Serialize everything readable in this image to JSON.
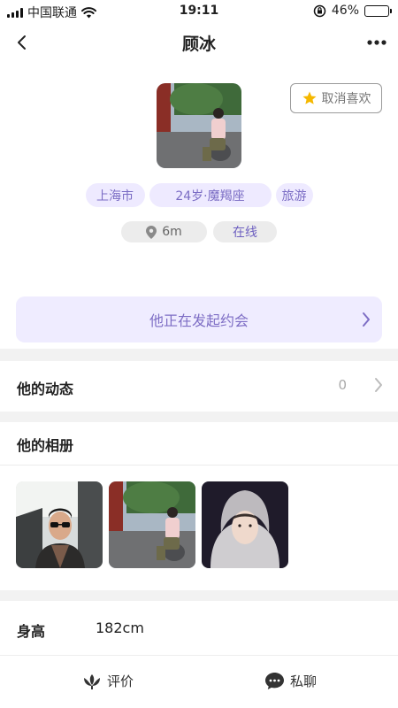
{
  "status_bar": {
    "carrier": "中国联通",
    "time": "19:11",
    "battery": "46%",
    "battery_level": 0.46,
    "icons": [
      "signal-icon",
      "wifi-icon",
      "orientation-lock-icon",
      "battery-icon"
    ]
  },
  "nav": {
    "title": "顾冰",
    "back_icon": "chevron-left-icon",
    "more_icon": "more-dots-icon"
  },
  "profile": {
    "unlike_label": "取消喜欢",
    "tags": [
      "上海市",
      "24岁·魔羯座",
      "旅游"
    ],
    "distance": "6m",
    "status": "在线"
  },
  "date_banner": {
    "label": "他正在发起约会"
  },
  "moments": {
    "label": "他的动态",
    "count": "0"
  },
  "album": {
    "label": "他的相册"
  },
  "info": {
    "height_label": "身高",
    "height_value": "182cm"
  },
  "tabbar": {
    "review": "评价",
    "chat": "私聊"
  },
  "colors": {
    "accent": "#7e6ec5",
    "tag_bg": "#eeeaff",
    "star": "#f5b800"
  }
}
